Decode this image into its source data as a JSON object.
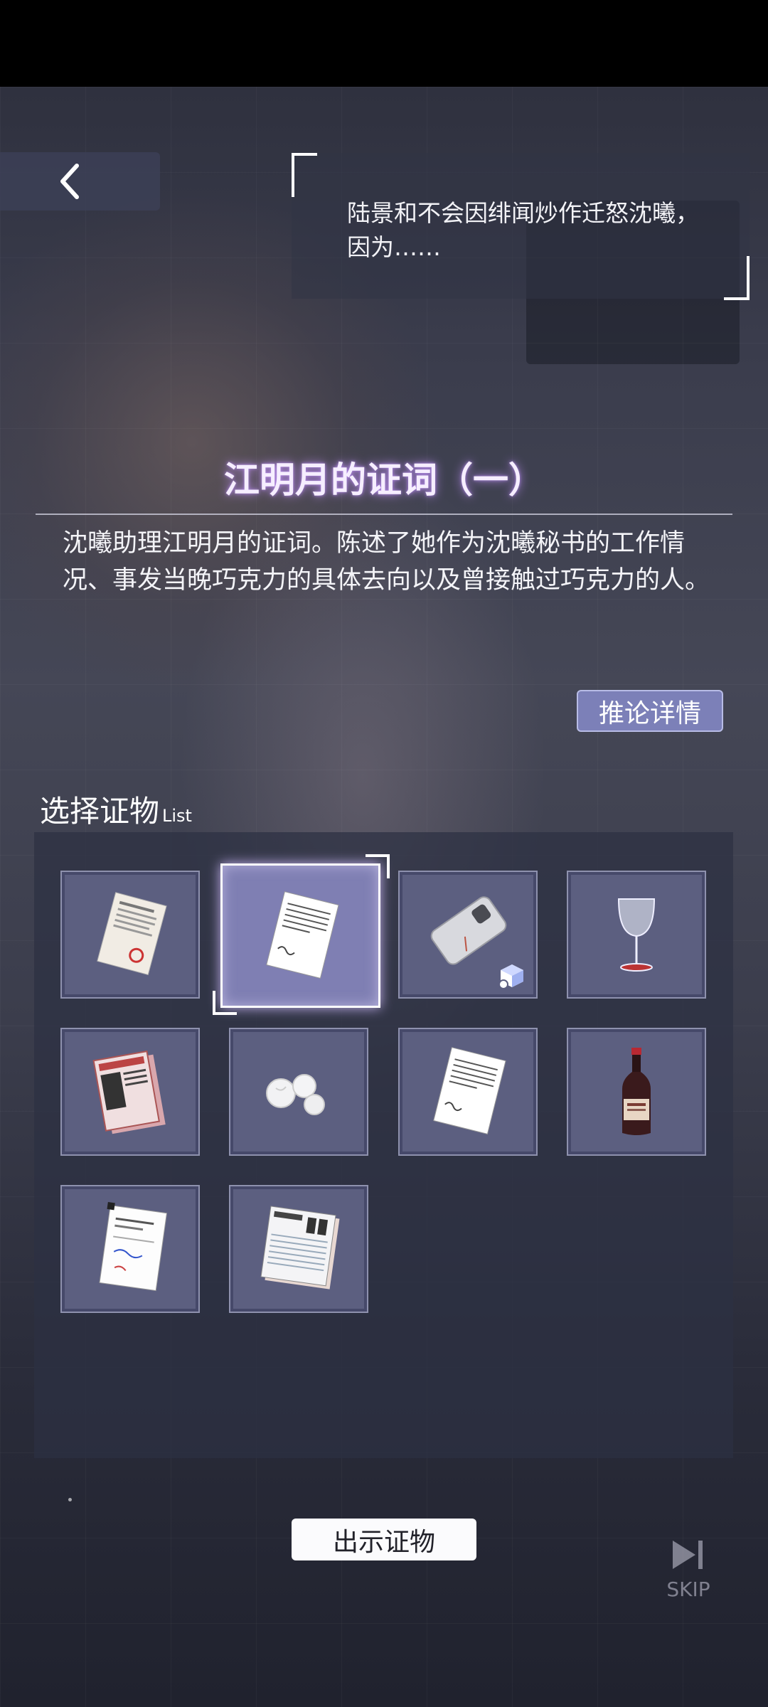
{
  "header": {
    "question": "陆景和不会因绯闻炒作迁怒沈曦，因为……"
  },
  "evidence": {
    "title": "江明月的证词（一）",
    "description": "沈曦助理江明月的证词。陈述了她作为沈曦秘书的工作情况、事发当晚巧克力的具体去向以及曾接触过巧克力的人。",
    "detail_button": "推论详情"
  },
  "selection": {
    "label": "选择证物",
    "label_sub": "List",
    "selected_index": 1,
    "items": [
      {
        "icon": "document-icon"
      },
      {
        "icon": "testimony-paper-01-icon"
      },
      {
        "icon": "smartphone-icon",
        "badge": "3d-view-icon"
      },
      {
        "icon": "wine-glass-icon"
      },
      {
        "icon": "magazine-icon"
      },
      {
        "icon": "tissue-balls-icon"
      },
      {
        "icon": "testimony-paper-02-icon"
      },
      {
        "icon": "wine-bottle-icon"
      },
      {
        "icon": "certificate-icon"
      },
      {
        "icon": "report-sheet-icon"
      }
    ]
  },
  "footer": {
    "show_button": "出示证物",
    "skip_label": "SKIP"
  }
}
